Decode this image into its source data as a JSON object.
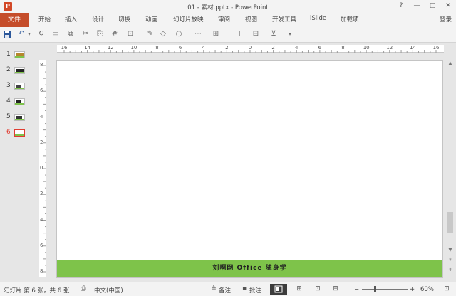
{
  "window": {
    "title": "01 - 素材.pptx - PowerPoint",
    "app_icon_letter": "P",
    "controls": [
      "?",
      "—",
      "▢",
      "✕"
    ]
  },
  "ribbon": {
    "file_tab": "文件",
    "tabs": [
      "开始",
      "插入",
      "设计",
      "切换",
      "动画",
      "幻灯片放映",
      "审阅",
      "视图",
      "开发工具",
      "iSlide",
      "加载项"
    ],
    "login": "登录"
  },
  "toolbar": {
    "icons": [
      "save-icon",
      "undo-icon",
      "dropdown-icon",
      "redo-icon",
      "rectangle-icon",
      "screenshot-icon",
      "cut-icon",
      "copy-icon",
      "format-painter-icon",
      "textbox-icon",
      "pen-icon",
      "shapes-icon",
      "align-icon",
      "arrange-icon",
      "group-icon",
      "present-icon"
    ]
  },
  "slide_panel": {
    "slides": [
      {
        "number": "1",
        "selected": false
      },
      {
        "number": "2",
        "selected": false
      },
      {
        "number": "3",
        "selected": false
      },
      {
        "number": "4",
        "selected": false
      },
      {
        "number": "5",
        "selected": false
      },
      {
        "number": "6",
        "selected": true
      }
    ]
  },
  "rulers": {
    "horizontal_labels": [
      "16",
      "14",
      "12",
      "10",
      "8",
      "6",
      "4",
      "2",
      "0",
      "2",
      "4",
      "6",
      "8",
      "10",
      "12",
      "14",
      "16"
    ],
    "vertical_labels": [
      "8",
      "6",
      "4",
      "2",
      "0",
      "2",
      "4",
      "6",
      "8"
    ]
  },
  "slide": {
    "footer_text": "刘啊网      Office 随身学",
    "footer_color": "#7ec34a"
  },
  "statusbar": {
    "slide_info": "幻灯片 第 6 张，共 6 张",
    "language": "中文(中国)",
    "notes_label": "备注",
    "comments_label": "批注",
    "zoom_minus": "−",
    "zoom_plus": "+",
    "zoom_level": "60%",
    "zoom_fraction": 0.6
  },
  "colors": {
    "accent": "#c54d2a",
    "selected_slide": "#e03c31"
  }
}
